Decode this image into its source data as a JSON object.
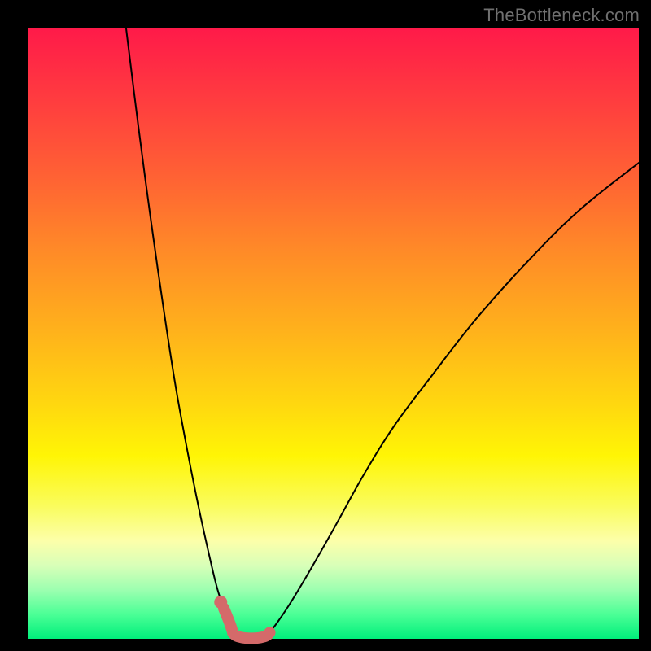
{
  "watermark": "TheBottleneck.com",
  "colors": {
    "curve_stroke": "#000000",
    "highlight_stroke": "#d46a6a",
    "highlight_dot": "#d46a6a",
    "frame": "#000000"
  },
  "chart_data": {
    "type": "line",
    "title": "",
    "xlabel": "",
    "ylabel": "",
    "xlim": [
      0,
      100
    ],
    "ylim": [
      0,
      100
    ],
    "series": [
      {
        "name": "left-curve",
        "x": [
          16,
          18,
          20,
          22,
          24,
          26,
          28,
          30,
          31,
          32,
          33,
          33.5
        ],
        "values": [
          100,
          84,
          69,
          55,
          42,
          31,
          21,
          12,
          8,
          5,
          2.5,
          1
        ]
      },
      {
        "name": "right-curve",
        "x": [
          39.5,
          41,
          43,
          46,
          50,
          55,
          60,
          66,
          73,
          81,
          90,
          100
        ],
        "values": [
          1,
          3,
          6,
          11,
          18,
          27,
          35,
          43,
          52,
          61,
          70,
          78
        ]
      },
      {
        "name": "valley-floor",
        "x": [
          33.5,
          34,
          35,
          36,
          37,
          38,
          39,
          39.5
        ],
        "values": [
          1,
          0.5,
          0.2,
          0.1,
          0.1,
          0.2,
          0.5,
          1
        ]
      }
    ],
    "highlight": {
      "range_x": [
        31.5,
        40.5
      ],
      "dot_x": 31.5,
      "dot_y": 6
    }
  }
}
